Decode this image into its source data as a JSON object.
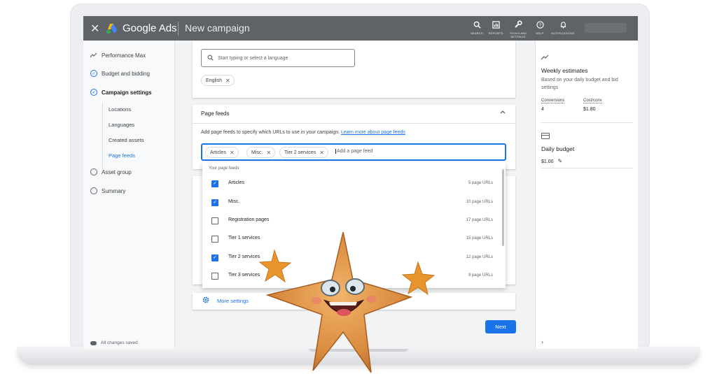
{
  "header": {
    "brand": "Google Ads",
    "page_title": "New campaign",
    "tools": [
      {
        "label": "SEARCH",
        "icon": "search-icon"
      },
      {
        "label": "REPORTS",
        "icon": "reports-icon"
      },
      {
        "label": "TOOLS AND SETTINGS",
        "icon": "wrench-icon"
      },
      {
        "label": "HELP",
        "icon": "help-icon"
      },
      {
        "label": "NOTIFICATIONS",
        "icon": "bell-icon"
      }
    ]
  },
  "sidebar": {
    "items": [
      {
        "label": "Performance Max"
      },
      {
        "label": "Budget and bidding"
      },
      {
        "label": "Campaign settings"
      },
      {
        "label": "Asset group"
      },
      {
        "label": "Summary"
      }
    ],
    "subitems": [
      {
        "label": "Locations"
      },
      {
        "label": "Languages"
      },
      {
        "label": "Created assets"
      },
      {
        "label": "Page feeds"
      }
    ],
    "status": "All changes saved"
  },
  "languages": {
    "placeholder": "Start typing or select a language",
    "chips": [
      "English"
    ]
  },
  "page_feeds": {
    "title": "Page feeds",
    "description": "Add page feeds to specify which URLs to use in your campaign.",
    "learn_more": "Learn more about page feeds",
    "chips": [
      "Articles",
      "Misc.",
      "Tier 2 services"
    ],
    "input_placeholder": "Add a page feed",
    "dropdown_header": "Your page feeds",
    "feeds": [
      {
        "name": "Articles",
        "count": "5 page URLs",
        "checked": true
      },
      {
        "name": "Misc.",
        "count": "10 page URLs",
        "checked": true
      },
      {
        "name": "Registration pages",
        "count": "17 page URLs",
        "checked": false
      },
      {
        "name": "Tier 1 services",
        "count": "15 page URLs",
        "checked": false
      },
      {
        "name": "Tier 2 services",
        "count": "12 page URLs",
        "checked": true
      },
      {
        "name": "Tier 3 services",
        "count": "9 page URLs",
        "checked": false
      }
    ]
  },
  "more_settings": "More settings",
  "next_button": "Next",
  "estimates": {
    "title": "Weekly estimates",
    "description": "Based on your daily budget and bid settings",
    "conversions_label": "Conversions",
    "conversions_value": "4",
    "cost_label": "Cost/conv",
    "cost_value": "$1.80"
  },
  "budget": {
    "title": "Daily budget",
    "value": "$1.00"
  },
  "colors": {
    "header": "#5f6368",
    "accent": "#1a73e8"
  }
}
